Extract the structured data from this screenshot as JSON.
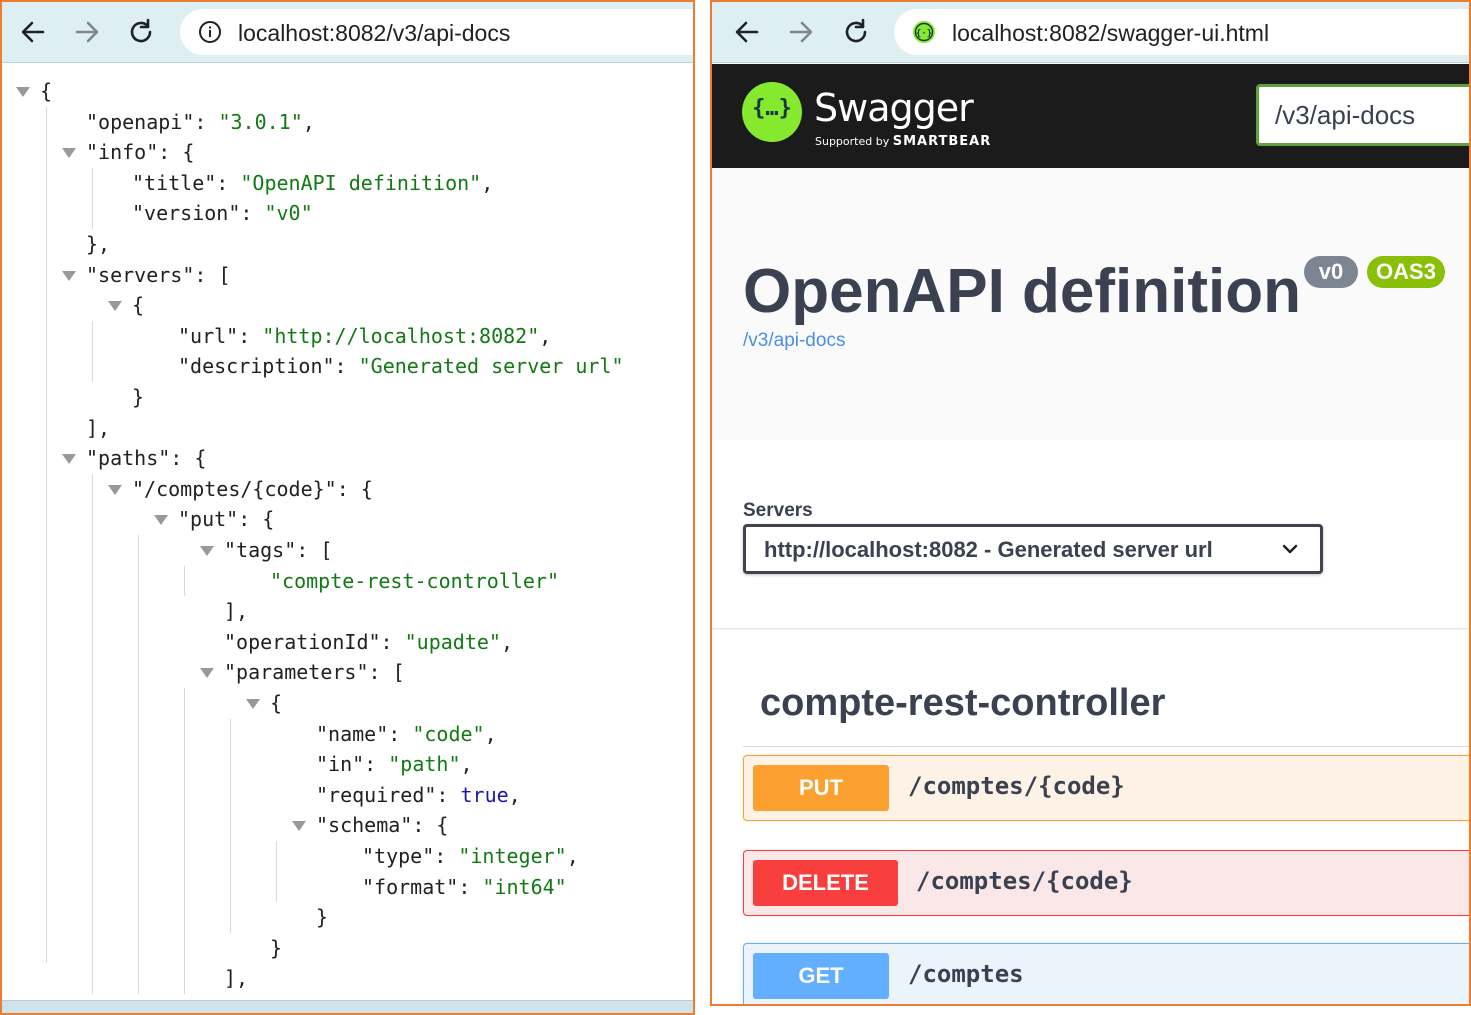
{
  "left_browser": {
    "url": "localhost:8082/v3/api-docs",
    "site_icon": "info-circle-icon"
  },
  "json_lines": [
    {
      "text": "{",
      "indent": 0,
      "toggle": true
    },
    {
      "key": "openapi",
      "value": "3.0.1",
      "trail": ",",
      "indent": 1
    },
    {
      "key": "info",
      "open": "{",
      "indent": 1,
      "toggle": true
    },
    {
      "key": "title",
      "value": "OpenAPI definition",
      "trail": ",",
      "indent": 2
    },
    {
      "key": "version",
      "value": "v0",
      "indent": 2
    },
    {
      "text": "},",
      "indent": 1
    },
    {
      "key": "servers",
      "open": "[",
      "indent": 1,
      "toggle": true
    },
    {
      "text": "{",
      "indent": 2,
      "toggle": true
    },
    {
      "key": "url",
      "value": "http://localhost:8082",
      "trail": ",",
      "indent": 3
    },
    {
      "key": "description",
      "value": "Generated server url",
      "indent": 3
    },
    {
      "text": "}",
      "indent": 2
    },
    {
      "text": "],",
      "indent": 1
    },
    {
      "key": "paths",
      "open": "{",
      "indent": 1,
      "toggle": true
    },
    {
      "key": "/comptes/{code}",
      "open": "{",
      "indent": 2,
      "toggle": true
    },
    {
      "key": "put",
      "open": "{",
      "indent": 3,
      "toggle": true
    },
    {
      "key": "tags",
      "open": "[",
      "indent": 4,
      "toggle": true
    },
    {
      "value": "compte-rest-controller",
      "indent": 5
    },
    {
      "text": "],",
      "indent": 4
    },
    {
      "key": "operationId",
      "value": "upadte",
      "trail": ",",
      "indent": 4
    },
    {
      "key": "parameters",
      "open": "[",
      "indent": 4,
      "toggle": true
    },
    {
      "text": "{",
      "indent": 5,
      "toggle": true
    },
    {
      "key": "name",
      "value": "code",
      "trail": ",",
      "indent": 6
    },
    {
      "key": "in",
      "value": "path",
      "trail": ",",
      "indent": 6
    },
    {
      "key": "required",
      "bool": "true",
      "trail": ",",
      "indent": 6
    },
    {
      "key": "schema",
      "open": "{",
      "indent": 6,
      "toggle": true
    },
    {
      "key": "type",
      "value": "integer",
      "trail": ",",
      "indent": 7
    },
    {
      "key": "format",
      "value": "int64",
      "indent": 7
    },
    {
      "text": "}",
      "indent": 6
    },
    {
      "text": "}",
      "indent": 5
    },
    {
      "text": "],",
      "indent": 4
    }
  ],
  "right_browser": {
    "url": "localhost:8082/swagger-ui.html",
    "site_icon": "swagger-site-icon"
  },
  "swagger": {
    "logo_glyph": "{…}",
    "brand": "Swagger",
    "supported_by": "Supported by",
    "smartbear": "SMARTBEAR",
    "spec_url_input": "/v3/api-docs",
    "title": "OpenAPI definition",
    "version_badge": "v0",
    "oas_badge": "OAS3",
    "spec_link": "/v3/api-docs",
    "servers_label": "Servers",
    "server_selected": "http://localhost:8082 - Generated server url",
    "tag": "compte-rest-controller",
    "operations": [
      {
        "method": "PUT",
        "path": "/comptes/{code}"
      },
      {
        "method": "DELETE",
        "path": "/comptes/{code}"
      },
      {
        "method": "GET",
        "path": "/comptes"
      }
    ]
  },
  "colors": {
    "frame": "#ED7D31",
    "put": "#fca130",
    "delete": "#f93e3e",
    "get": "#61affe",
    "swagger_green": "#85ea2d"
  }
}
